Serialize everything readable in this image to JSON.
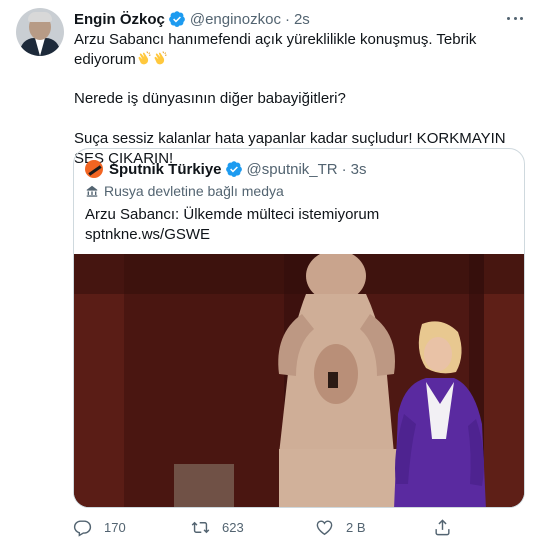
{
  "author": {
    "name": "Engin Özkoç",
    "handle": "@enginozkoc",
    "separator": "·",
    "time": "2s"
  },
  "tweet": {
    "line1": "Arzu Sabancı hanımefendi açık yüreklilikle konuşmuş. Tebrik ediyorum",
    "line2": "Nerede iş dünyasının diğer babayiğitleri?",
    "line3": "Suça sessiz kalanlar hata yapanlar kadar suçludur! KORKMAYIN SES ÇIKARIN!"
  },
  "quoted": {
    "name": "Sputnik Türkiye",
    "handle": "@sputnik_TR",
    "separator": "·",
    "time": "3s",
    "state_label": "Rusya devletine bağlı medya",
    "text": "Arzu Sabancı: Ülkemde mülteci istemiyorum",
    "link": "sptnkne.ws/GSWE"
  },
  "actions": {
    "replies": "170",
    "retweets": "623",
    "likes": "2 B"
  },
  "colors": {
    "accent": "#1d9bf0",
    "muted": "#536471",
    "border": "#cfd9de"
  },
  "icons": [
    "more-icon",
    "verified-badge-icon",
    "clapping-hands-icon",
    "state-media-icon",
    "reply-icon",
    "retweet-icon",
    "like-icon",
    "share-icon"
  ]
}
